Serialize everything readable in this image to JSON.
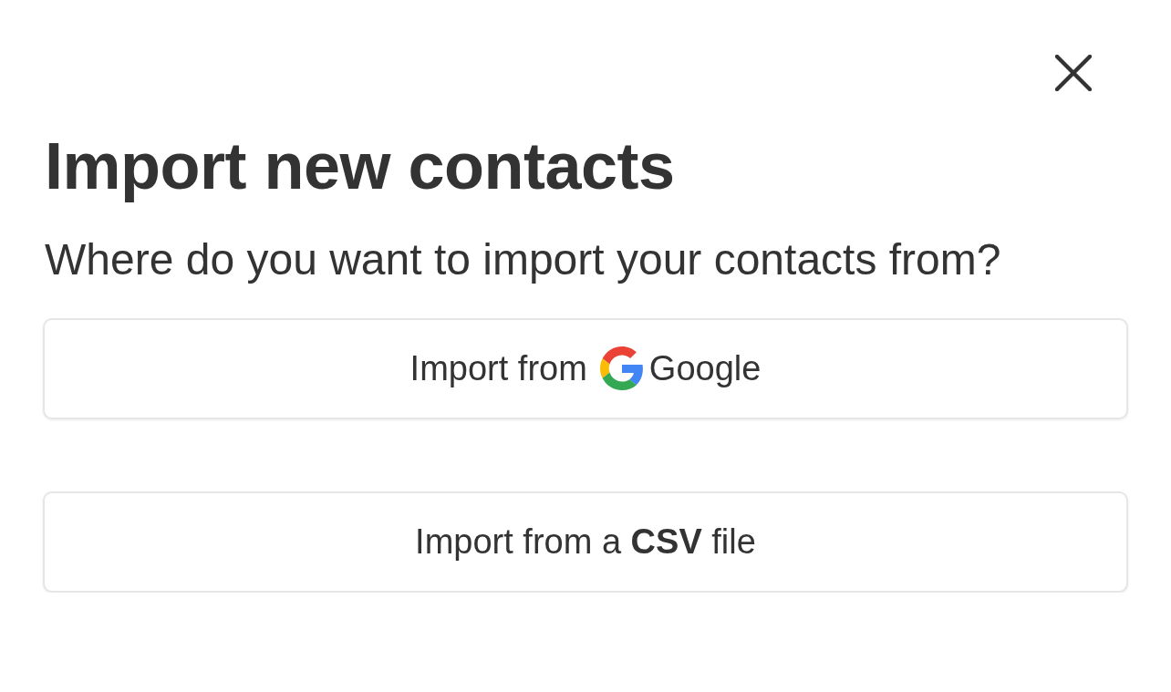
{
  "dialog": {
    "title": "Import new contacts",
    "subtitle": "Where do you want to import your contacts from?",
    "buttons": [
      {
        "kind": "google",
        "label_before": "Import from",
        "label_after": "Google"
      },
      {
        "kind": "plain",
        "label": "Import from a **CSV** file"
      }
    ]
  }
}
